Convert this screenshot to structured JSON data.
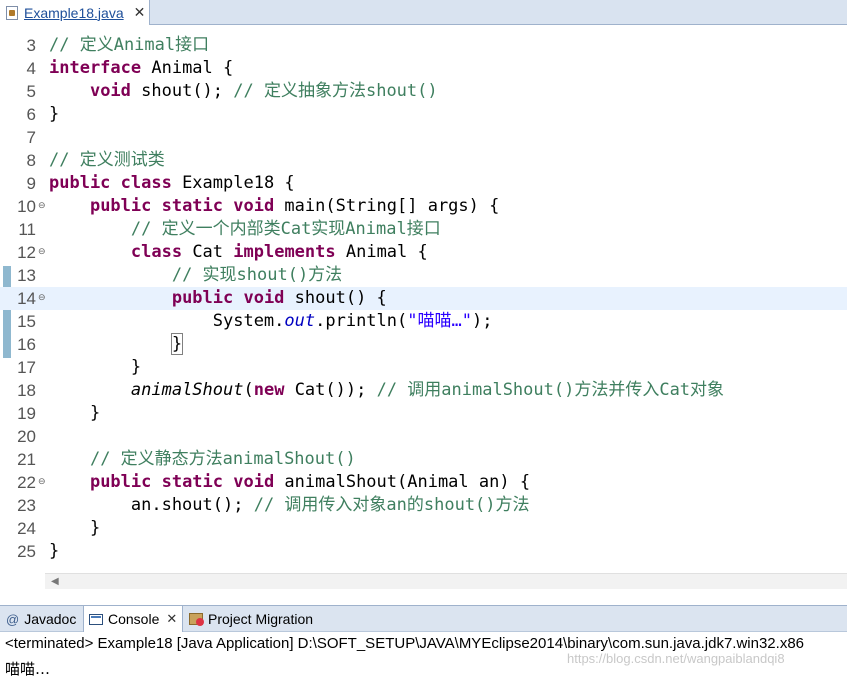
{
  "editor_tab": {
    "title": "Example18.java",
    "close": "✕"
  },
  "code_lines": [
    {
      "n": "3",
      "fold": "",
      "html": "<span class='cm'>// 定义Animal接口</span>"
    },
    {
      "n": "4",
      "fold": "",
      "html": "<span class='kw'>interface</span> Animal {"
    },
    {
      "n": "5",
      "fold": "",
      "html": "    <span class='kw'>void</span> shout(); <span class='cm'>// 定义抽象方法shout()</span>"
    },
    {
      "n": "6",
      "fold": "",
      "html": "}"
    },
    {
      "n": "7",
      "fold": "",
      "html": ""
    },
    {
      "n": "8",
      "fold": "",
      "html": "<span class='cm'>// 定义测试类</span>"
    },
    {
      "n": "9",
      "fold": "",
      "html": "<span class='kw'>public class</span> Example18 {"
    },
    {
      "n": "10",
      "fold": "⊖",
      "html": "    <span class='kw'>public static void</span> main(String[] args) {"
    },
    {
      "n": "11",
      "fold": "",
      "html": "        <span class='cm'>// 定义一个内部类Cat实现Animal接口</span>"
    },
    {
      "n": "12",
      "fold": "⊖",
      "html": "        <span class='kw'>class</span> Cat <span class='kw'>implements</span> Animal {"
    },
    {
      "n": "13",
      "fold": "",
      "html": "            <span class='cm'>// 实现shout()方法</span>"
    },
    {
      "n": "14",
      "fold": "⊖",
      "html": "            <span class='kw'>public void</span> shout() {"
    },
    {
      "n": "15",
      "fold": "",
      "html": "                System.<span class='fd'>out</span>.println(<span class='st'>\"喵喵…\"</span>);"
    },
    {
      "n": "16",
      "fold": "",
      "html": "            <span class='brk'>}</span>"
    },
    {
      "n": "17",
      "fold": "",
      "html": "        }"
    },
    {
      "n": "18",
      "fold": "",
      "html": "        <span class='it'>animalShout</span>(<span class='kw'>new</span> Cat()); <span class='cm'>// 调用animalShout()方法并传入Cat对象</span>"
    },
    {
      "n": "19",
      "fold": "",
      "html": "    }"
    },
    {
      "n": "20",
      "fold": "",
      "html": ""
    },
    {
      "n": "21",
      "fold": "",
      "html": "    <span class='cm'>// 定义静态方法animalShout()</span>"
    },
    {
      "n": "22",
      "fold": "⊖",
      "html": "    <span class='kw'>public static void</span> animalShout(Animal an) {"
    },
    {
      "n": "23",
      "fold": "",
      "html": "        an.shout(); <span class='cm'>// 调用传入对象an的shout()方法</span>"
    },
    {
      "n": "24",
      "fold": "",
      "html": "    }"
    },
    {
      "n": "25",
      "fold": "",
      "html": "}"
    }
  ],
  "current_line": "14",
  "bottom_tabs": {
    "javadoc": "Javadoc",
    "console": "Console",
    "console_close": "✕",
    "project_migration": "Project Migration"
  },
  "console": {
    "terminated": "<terminated> Example18 [Java Application] D:\\SOFT_SETUP\\JAVA\\MYEclipse2014\\binary\\com.sun.java.jdk7.win32.x86",
    "output": "喵喵…"
  },
  "watermark": "https://blog.csdn.net/wangpaiblandqi8"
}
